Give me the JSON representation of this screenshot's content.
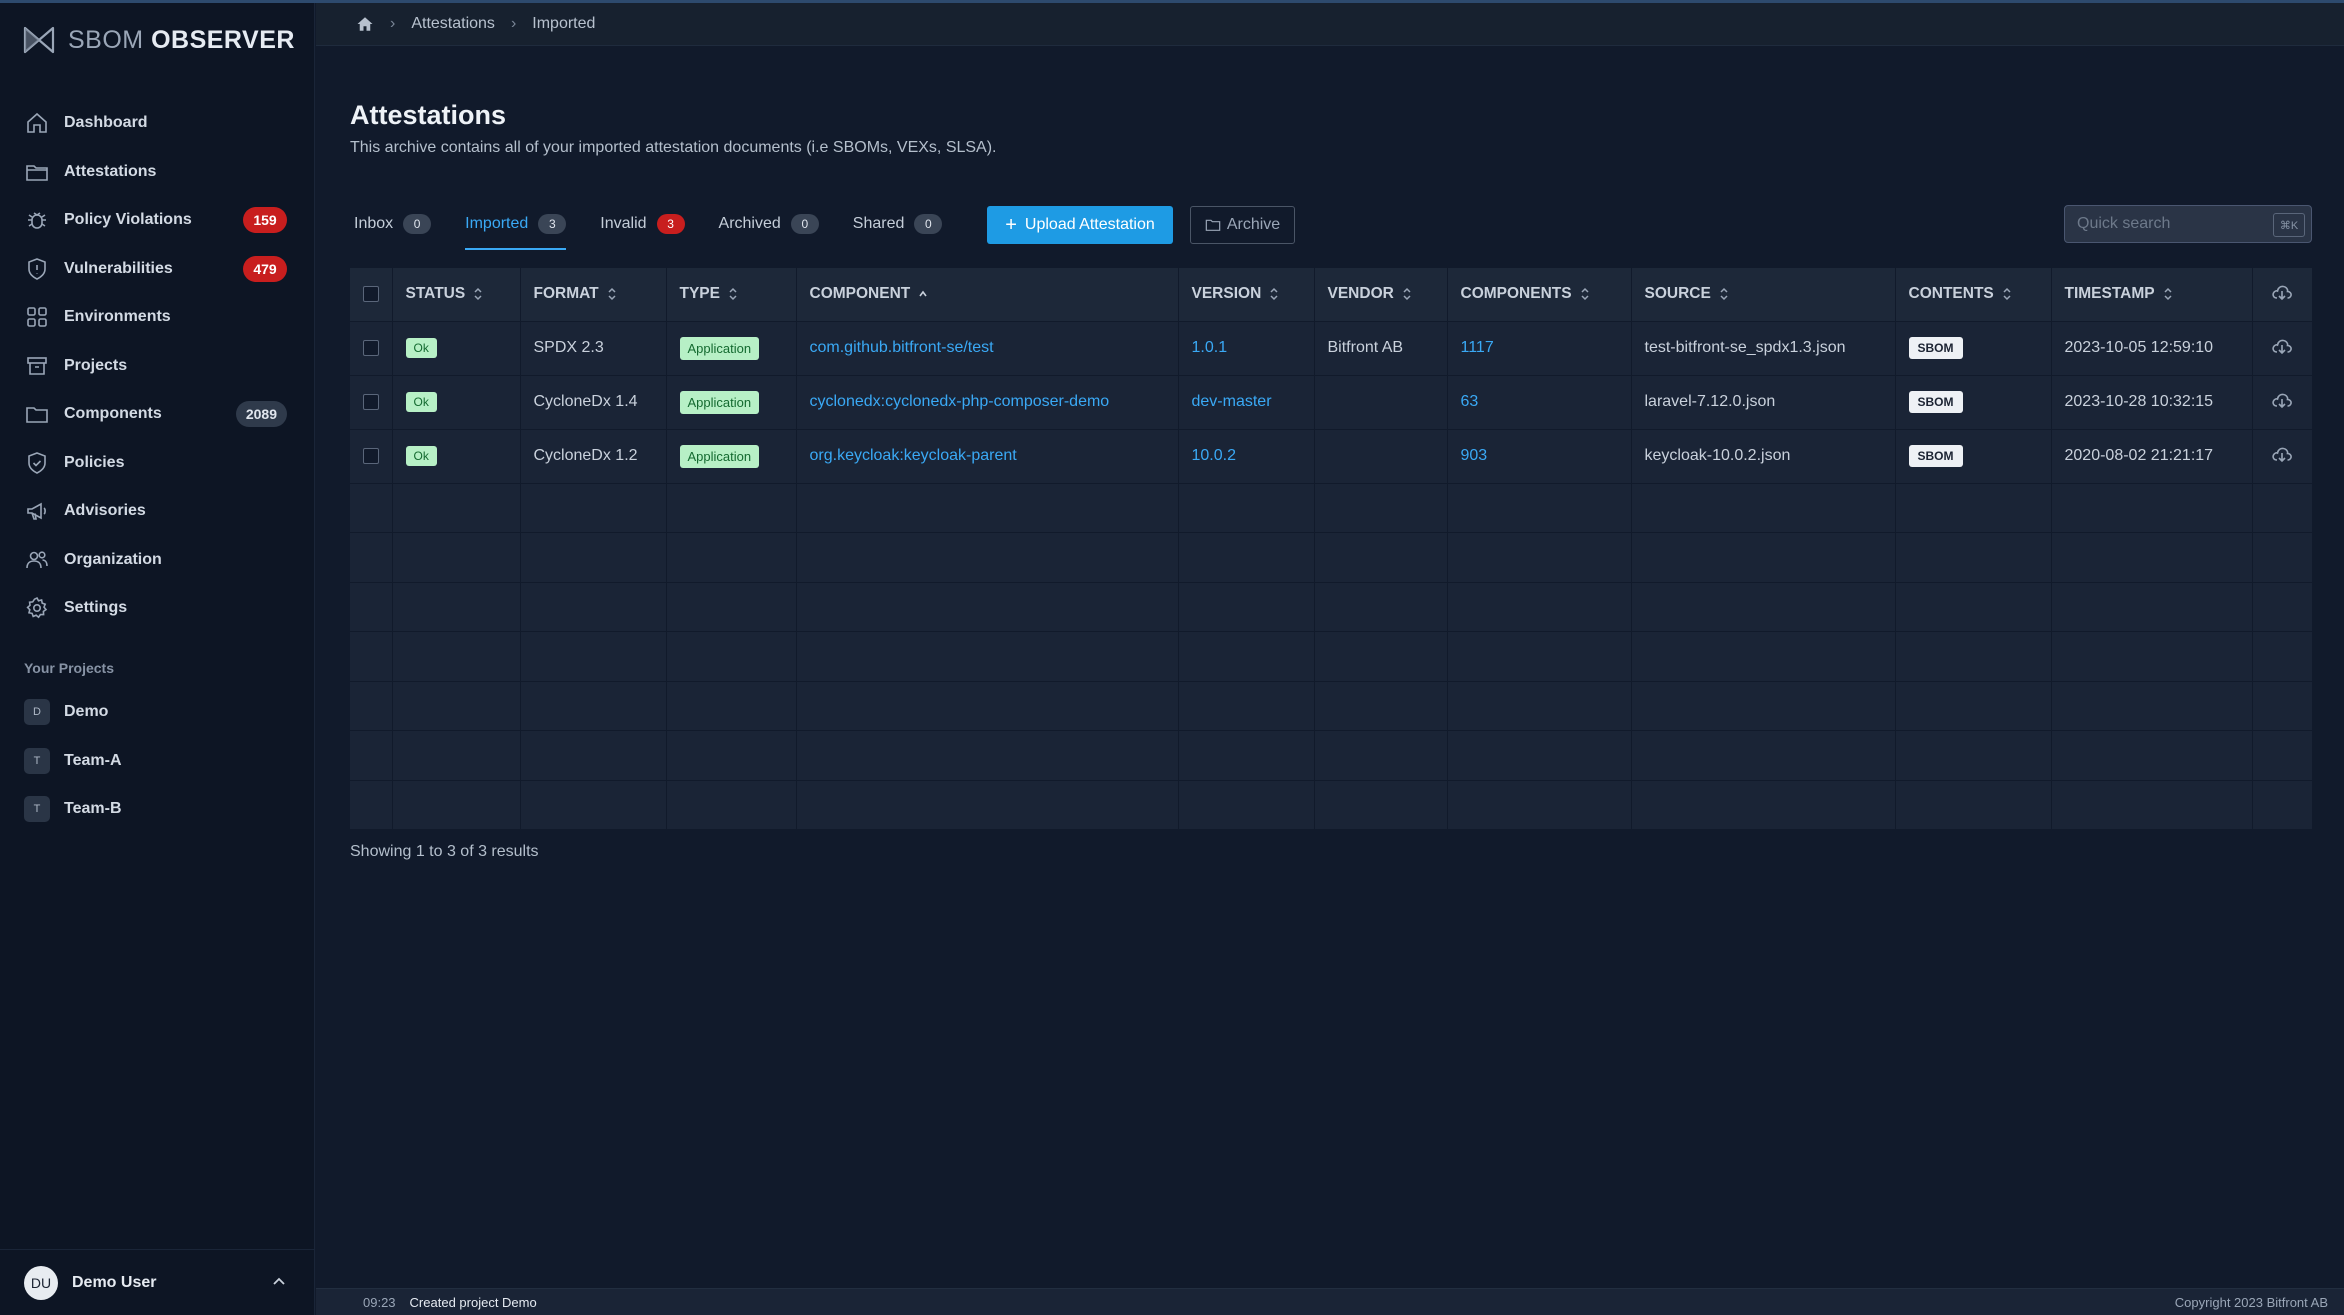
{
  "app": {
    "logo_light": "SBOM",
    "logo_bold": "OBSERVER"
  },
  "sidebar": {
    "items": [
      {
        "label": "Dashboard",
        "icon": "home-icon"
      },
      {
        "label": "Attestations",
        "icon": "folder-icon"
      },
      {
        "label": "Policy Violations",
        "icon": "bug-icon",
        "badge": "159"
      },
      {
        "label": "Vulnerabilities",
        "icon": "shield-alert-icon",
        "badge": "479"
      },
      {
        "label": "Environments",
        "icon": "grid-icon"
      },
      {
        "label": "Projects",
        "icon": "archive-icon"
      },
      {
        "label": "Components",
        "icon": "folder-icon",
        "badge": "2089"
      },
      {
        "label": "Policies",
        "icon": "shield-check-icon"
      },
      {
        "label": "Advisories",
        "icon": "megaphone-icon"
      },
      {
        "label": "Organization",
        "icon": "users-icon"
      },
      {
        "label": "Settings",
        "icon": "gear-icon"
      }
    ],
    "projects_title": "Your Projects",
    "projects": [
      {
        "initial": "D",
        "label": "Demo"
      },
      {
        "initial": "T",
        "label": "Team-A"
      },
      {
        "initial": "T",
        "label": "Team-B"
      }
    ],
    "user": {
      "initials": "DU",
      "name": "Demo User"
    }
  },
  "breadcrumb": [
    "Attestations",
    "Imported"
  ],
  "main": {
    "title": "Attestations",
    "description": "This archive contains all of your imported attestation documents (i.e SBOMs, VEXs, SLSA).",
    "tabs": [
      {
        "label": "Inbox",
        "count": "0"
      },
      {
        "label": "Imported",
        "count": "3"
      },
      {
        "label": "Invalid",
        "count": "3"
      },
      {
        "label": "Archived",
        "count": "0"
      },
      {
        "label": "Shared",
        "count": "0"
      }
    ],
    "upload_label": "Upload Attestation",
    "archive_label": "Archive",
    "search": {
      "placeholder": "Quick search",
      "shortcut": "⌘K"
    },
    "table": {
      "columns": [
        "STATUS",
        "FORMAT",
        "TYPE",
        "COMPONENT",
        "VERSION",
        "VENDOR",
        "COMPONENTS",
        "SOURCE",
        "CONTENTS",
        "TIMESTAMP"
      ],
      "rows": [
        {
          "status": "Ok",
          "format": "SPDX 2.3",
          "type": "Application",
          "component": "com.github.bitfront-se/test",
          "version": "1.0.1",
          "vendor": "Bitfront AB",
          "components": "1117",
          "source": "test-bitfront-se_spdx1.3.json",
          "contents": "SBOM",
          "timestamp": "2023-10-05 12:59:10"
        },
        {
          "status": "Ok",
          "format": "CycloneDx 1.4",
          "type": "Application",
          "component": "cyclonedx:cyclonedx-php-composer-demo",
          "version": "dev-master",
          "vendor": "",
          "components": "63",
          "source": "laravel-7.12.0.json",
          "contents": "SBOM",
          "timestamp": "2023-10-28 10:32:15"
        },
        {
          "status": "Ok",
          "format": "CycloneDx 1.2",
          "type": "Application",
          "component": "org.keycloak:keycloak-parent",
          "version": "10.0.2",
          "vendor": "",
          "components": "903",
          "source": "keycloak-10.0.2.json",
          "contents": "SBOM",
          "timestamp": "2020-08-02 21:21:17"
        }
      ]
    },
    "results_text": "Showing 1 to 3 of 3 results"
  },
  "footer": {
    "time": "09:23",
    "message": "Created project Demo",
    "copyright": "Copyright 2023 Bitfront AB"
  },
  "colors": {
    "accent": "#1e9be4",
    "link": "#3aa9f5",
    "danger": "#c81e1e",
    "ok": "#b7f0c6"
  }
}
